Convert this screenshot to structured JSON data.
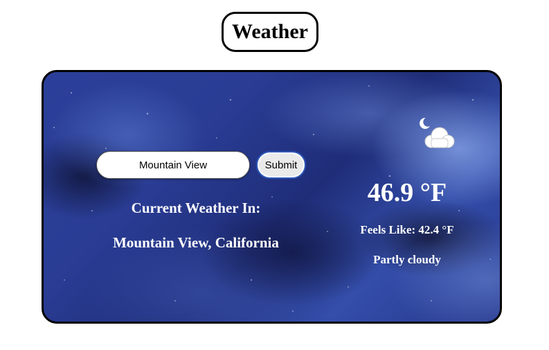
{
  "header": {
    "title": "Weather"
  },
  "search": {
    "value": "Mountain View",
    "submit_label": "Submit"
  },
  "location": {
    "heading": "Current Weather In:",
    "name": "Mountain View, California"
  },
  "current": {
    "temperature": "46.9 °F",
    "feels_like": "Feels Like: 42.4 °F",
    "condition": "Partly cloudy",
    "icon": "partly-cloudy-night-icon"
  },
  "colors": {
    "card_background": "#2b3f9a",
    "text": "#ffffff",
    "submit_border": "#2d57b8"
  }
}
